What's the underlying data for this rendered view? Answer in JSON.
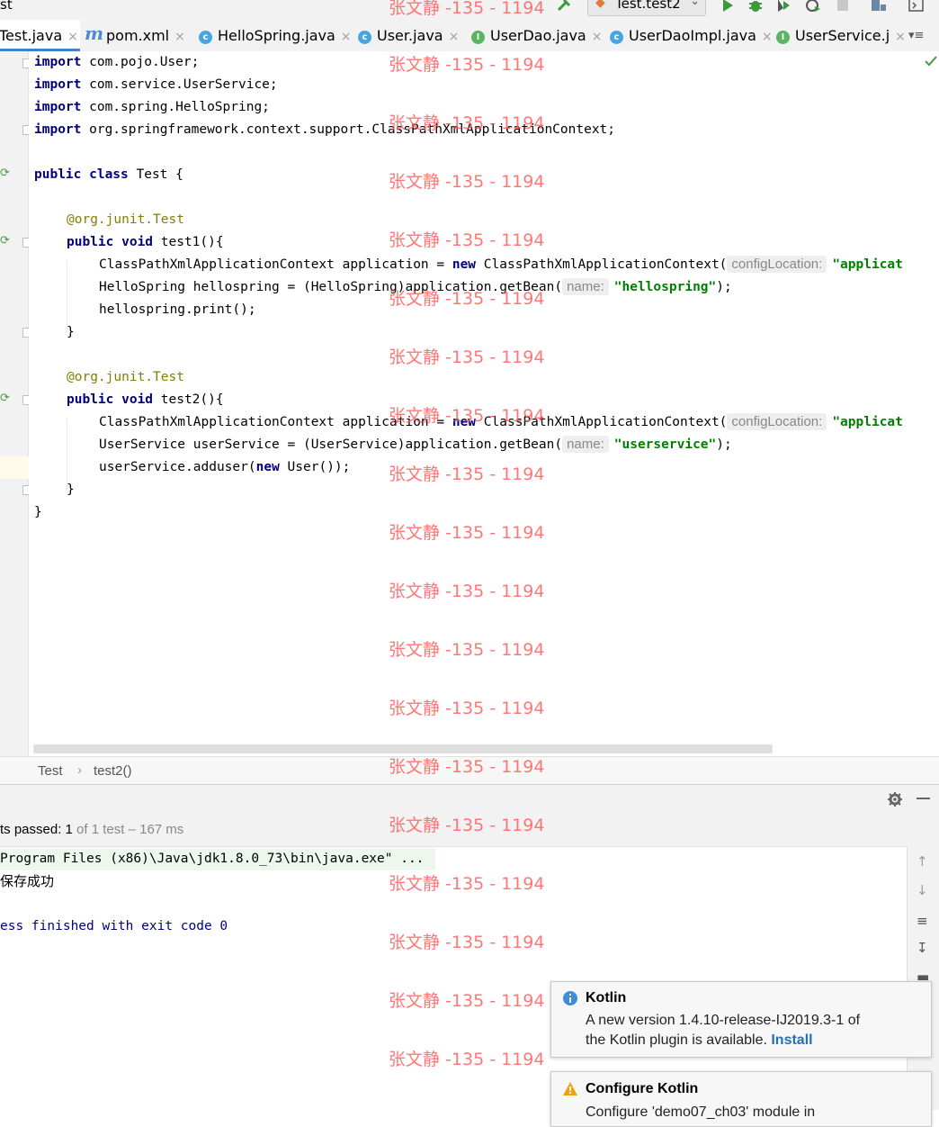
{
  "toolbar": {
    "title_fragment": "st",
    "run_config": "Test.test2"
  },
  "tabs": [
    {
      "label": "Test.java",
      "icon": "class-icon",
      "active": true
    },
    {
      "label": "pom.xml",
      "icon": "maven-icon"
    },
    {
      "label": "HelloSpring.java",
      "icon": "class-icon"
    },
    {
      "label": "User.java",
      "icon": "class-icon"
    },
    {
      "label": "UserDao.java",
      "icon": "interface-icon"
    },
    {
      "label": "UserDaoImpl.java",
      "icon": "class-icon"
    },
    {
      "label": "UserService.j",
      "icon": "interface-icon"
    }
  ],
  "tab_overflow": "▾≡",
  "code": {
    "imports": [
      {
        "kw": "import",
        "rest": " com.pojo.User;"
      },
      {
        "kw": "import",
        "rest": " com.service.UserService;"
      },
      {
        "kw": "import",
        "rest": " com.spring.HelloSpring;"
      },
      {
        "kw": "import",
        "rest": " org.springframework.context.support.ClassPathXmlApplicationContext;"
      }
    ],
    "class_kw": "public class",
    "class_name": " Test {",
    "annotation_prefix": "@org.junit.",
    "annotation_name": "Test",
    "method_kw": "public void",
    "test1_sig": " test1(){",
    "test2_sig": " test2(){",
    "ctx_decl": "ClassPathXmlApplicationContext application = ",
    "new_kw": "new",
    "ctx_ctor": " ClassPathXmlApplicationContext(",
    "hint_config": "configLocation:",
    "str_applicat": "\"applicat",
    "hs_decl": "HelloSpring hellospring = (HelloSpring)application.getBean(",
    "hint_name": "name:",
    "str_hellospring": "\"hellospring\"",
    "close_paren": ");",
    "hs_print": "hellospring.print();",
    "us_decl": "UserService userService = (UserService)application.getBean(",
    "str_userservice": "\"userservice\"",
    "adduser_pre": "userService.adduser(",
    "adduser_post": " User());",
    "brace_close": "}"
  },
  "breadcrumb": {
    "class": "Test",
    "sep": "›",
    "method": "test2()"
  },
  "results": {
    "prefix": "ts passed: ",
    "passed": "1",
    "rest": " of 1 test – 167 ms"
  },
  "console": {
    "cmd": "Program Files (x86)\\Java\\jdk1.8.0_73\\bin\\java.exe\" ...",
    "output": "保存成功",
    "exit": "ess finished with exit code 0"
  },
  "notifications": [
    {
      "title": "Kotlin",
      "line1": "A new version 1.4.10-release-IJ2019.3-1 of",
      "line2": "the Kotlin plugin is available. ",
      "link": "Install"
    },
    {
      "title": "Configure Kotlin",
      "line1": "Configure 'demo07_ch03' module in"
    }
  ],
  "watermark": "张文静 -135 - 1194",
  "colors": {
    "keyword": "#000080",
    "string": "#008000",
    "annotation": "#808000",
    "accent": "#4083c9",
    "watermark": "#ff5a5a"
  }
}
